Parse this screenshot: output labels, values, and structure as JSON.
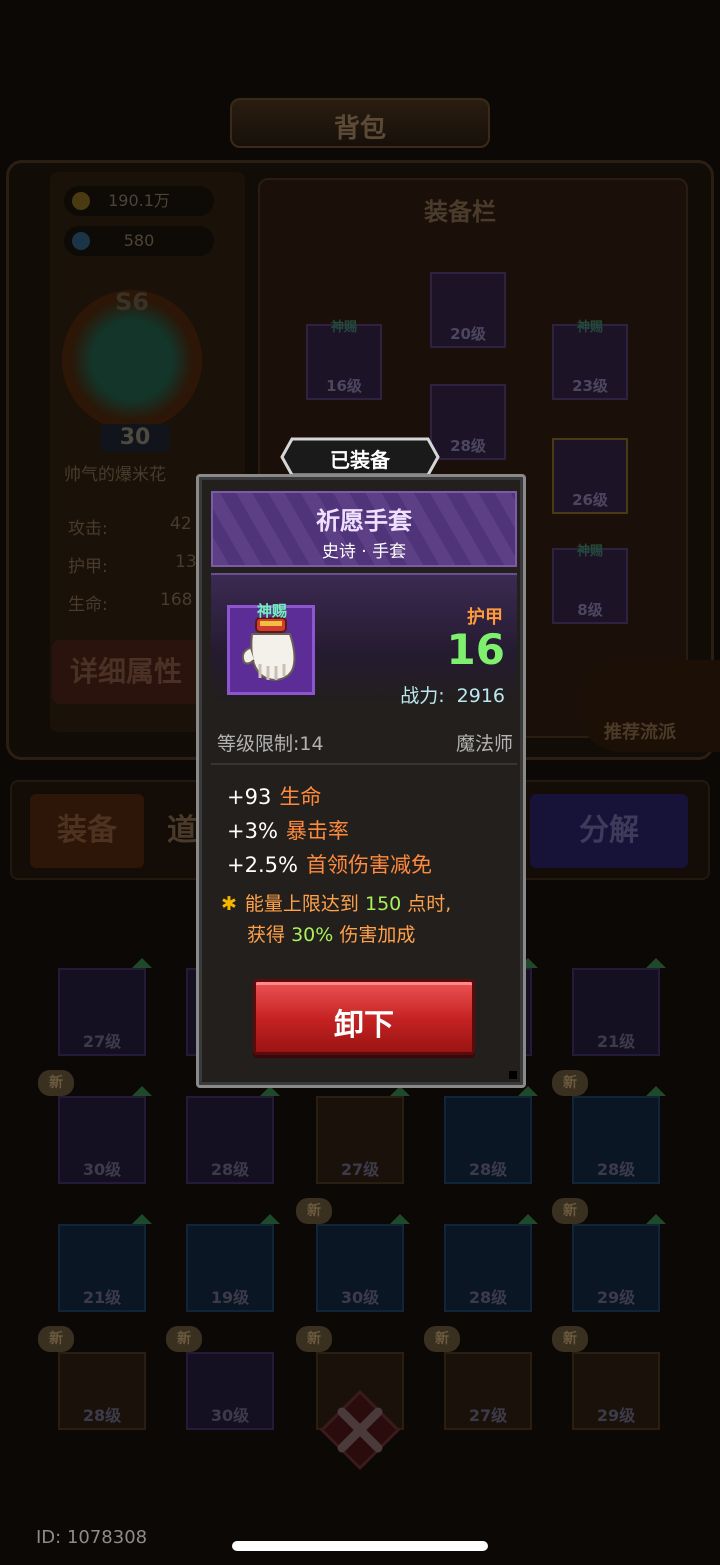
{
  "header": {
    "title": "背包"
  },
  "currency": {
    "gold": "190.1万",
    "gems": "580"
  },
  "character": {
    "rank": "S6",
    "level": "30",
    "name": "帅气的爆米花",
    "stats": [
      {
        "label": "攻击:",
        "value": "42"
      },
      {
        "label": "护甲:",
        "value": "13"
      },
      {
        "label": "生命:",
        "value": "168"
      }
    ],
    "detail_button": "详细属性"
  },
  "equip_panel": {
    "title": "装备栏",
    "slots": [
      {
        "level": "20级",
        "tag": ""
      },
      {
        "level": "16级",
        "tag": "神赐"
      },
      {
        "level": "23级",
        "tag": "神赐"
      },
      {
        "level": "28级",
        "tag": ""
      },
      {
        "level": "26级",
        "tag": ""
      },
      {
        "level": "8级",
        "tag": "神赐"
      }
    ],
    "recommend_label": "推荐流派"
  },
  "tabs": {
    "equipment": "装备",
    "items": "道",
    "decompose": "分解"
  },
  "inventory": [
    {
      "level": "27级",
      "new": ""
    },
    {
      "level": "",
      "new": ""
    },
    {
      "level": "",
      "new": ""
    },
    {
      "level": "",
      "new": ""
    },
    {
      "level": "21级",
      "new": ""
    },
    {
      "level": "30级",
      "new": "新"
    },
    {
      "level": "28级",
      "new": ""
    },
    {
      "level": "27级",
      "new": ""
    },
    {
      "level": "28级",
      "new": ""
    },
    {
      "level": "28级",
      "new": "新"
    },
    {
      "level": "21级",
      "new": ""
    },
    {
      "level": "19级",
      "new": ""
    },
    {
      "level": "30级",
      "new": "新"
    },
    {
      "level": "28级",
      "new": ""
    },
    {
      "level": "29级",
      "new": "新"
    },
    {
      "level": "28级",
      "new": "新"
    },
    {
      "level": "30级",
      "new": "新"
    },
    {
      "level": "",
      "new": "新"
    },
    {
      "level": "27级",
      "new": "新"
    },
    {
      "level": "29级",
      "new": "新"
    }
  ],
  "popup": {
    "equipped_label": "已装备",
    "item_name": "祈愿手套",
    "item_type": "史诗 · 手套",
    "divine_tag": "神赐",
    "item_icon": "glove-icon",
    "main_stat_name": "护甲",
    "main_stat_value": "16",
    "power_label": "战力:",
    "power_value": "2916",
    "level_req": "等级限制:14",
    "class_req": "魔法师",
    "bonuses": [
      {
        "value": "+93",
        "name": "生命"
      },
      {
        "value": "+3%",
        "name": "暴击率"
      },
      {
        "value": "+2.5%",
        "name": "首领伤害减免"
      }
    ],
    "special": {
      "part1": "能量上限达到",
      "threshold": "150",
      "part2": "点时,",
      "part3": "获得",
      "bonus": "30%",
      "part4": "伤害加成"
    },
    "unequip_button": "卸下"
  },
  "footer": {
    "id_text": "ID: 1078308"
  },
  "colors": {
    "epic_purple": "#5d3f86",
    "stat_orange": "#ff9a3c",
    "stat_green": "#7ff06d",
    "button_red": "#c32121"
  }
}
